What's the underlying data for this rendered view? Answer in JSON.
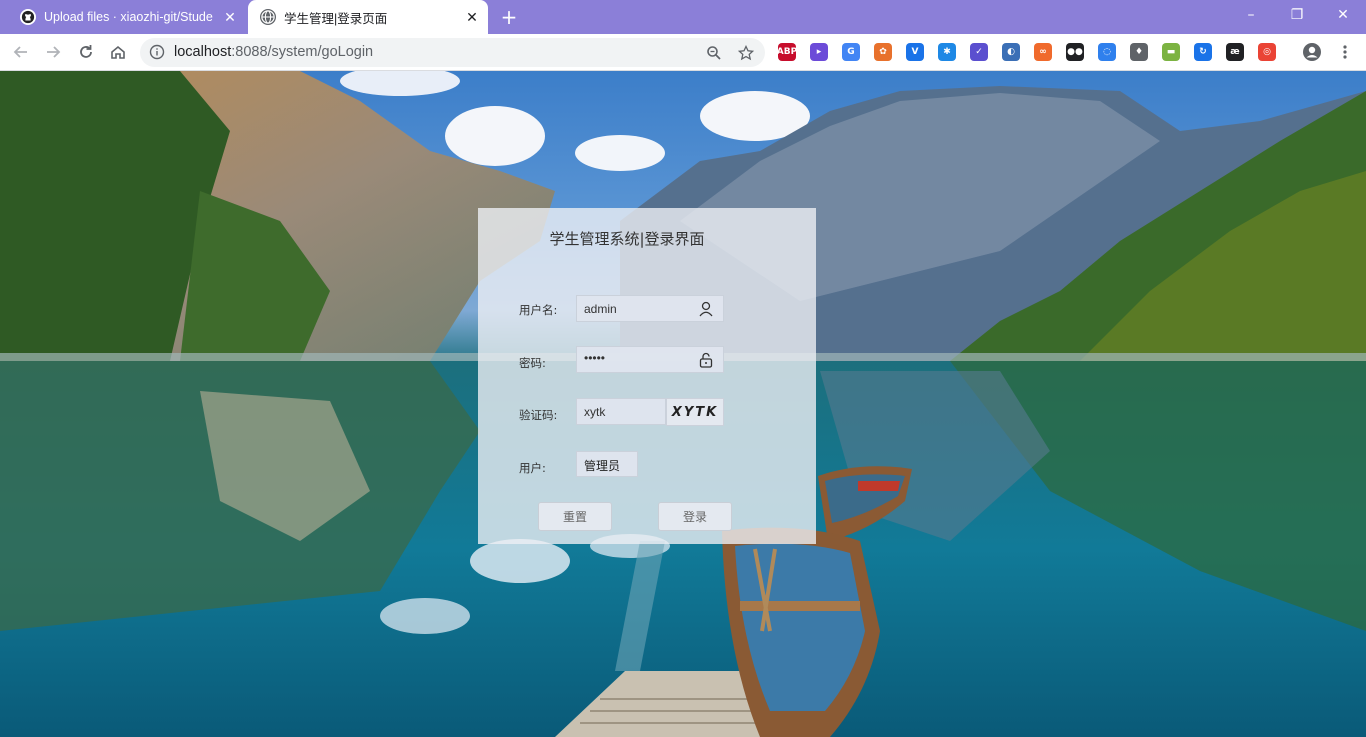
{
  "browser": {
    "tabs": [
      {
        "title": "Upload files · xiaozhi-git/Stude",
        "active": false,
        "favicon": "github-icon"
      },
      {
        "title": "学生管理|登录页面",
        "active": true,
        "favicon": "globe-icon"
      }
    ],
    "new_tab_label": "+",
    "window_controls": {
      "minimize": "–",
      "maximize": "❐",
      "close": "✕"
    },
    "address": {
      "host": "localhost",
      "path": ":8088/system/goLogin"
    },
    "extensions": [
      {
        "name": "adblock-plus-icon",
        "label": "ABP",
        "color": "#c70d2c"
      },
      {
        "name": "cursor-extension-icon",
        "label": "▸",
        "color": "#6c4bd8"
      },
      {
        "name": "google-translate-icon",
        "label": "G",
        "color": "#4285f4"
      },
      {
        "name": "nodes-extension-icon",
        "label": "✿",
        "color": "#e8712c"
      },
      {
        "name": "vue-devtools-icon",
        "label": "V",
        "color": "#1a73e8"
      },
      {
        "name": "snowflake-extension-icon",
        "label": "✱",
        "color": "#1e88e5"
      },
      {
        "name": "check-circle-extension-icon",
        "label": "✓",
        "color": "#5b4fcf"
      },
      {
        "name": "compass-extension-icon",
        "label": "◐",
        "color": "#3b6fb6"
      },
      {
        "name": "infinity-extension-icon",
        "label": "∞",
        "color": "#f06a2c"
      },
      {
        "name": "tampermonkey-icon",
        "label": "●●",
        "color": "#202124"
      },
      {
        "name": "loading-extension-icon",
        "label": "◌",
        "color": "#2f80ed"
      },
      {
        "name": "bulb-extension-icon",
        "label": "♦",
        "color": "#5f6368"
      },
      {
        "name": "grass-extension-icon",
        "label": "▬",
        "color": "#7cb342"
      },
      {
        "name": "refresh-extension-icon",
        "label": "↻",
        "color": "#1a73e8"
      },
      {
        "name": "ae-extension-icon",
        "label": "æ",
        "color": "#202124"
      },
      {
        "name": "chrome-extension-icon",
        "label": "◎",
        "color": "#ea4335"
      }
    ]
  },
  "login": {
    "title": "学生管理系统|登录界面",
    "username_label": "用户名:",
    "username_value": "admin",
    "password_label": "密码:",
    "password_value": "•••••",
    "captcha_label": "验证码:",
    "captcha_value": "xytk",
    "captcha_image_text": "XYTK",
    "role_label": "用户:",
    "role_value": "管理员",
    "reset_button": "重置",
    "login_button": "登录"
  }
}
